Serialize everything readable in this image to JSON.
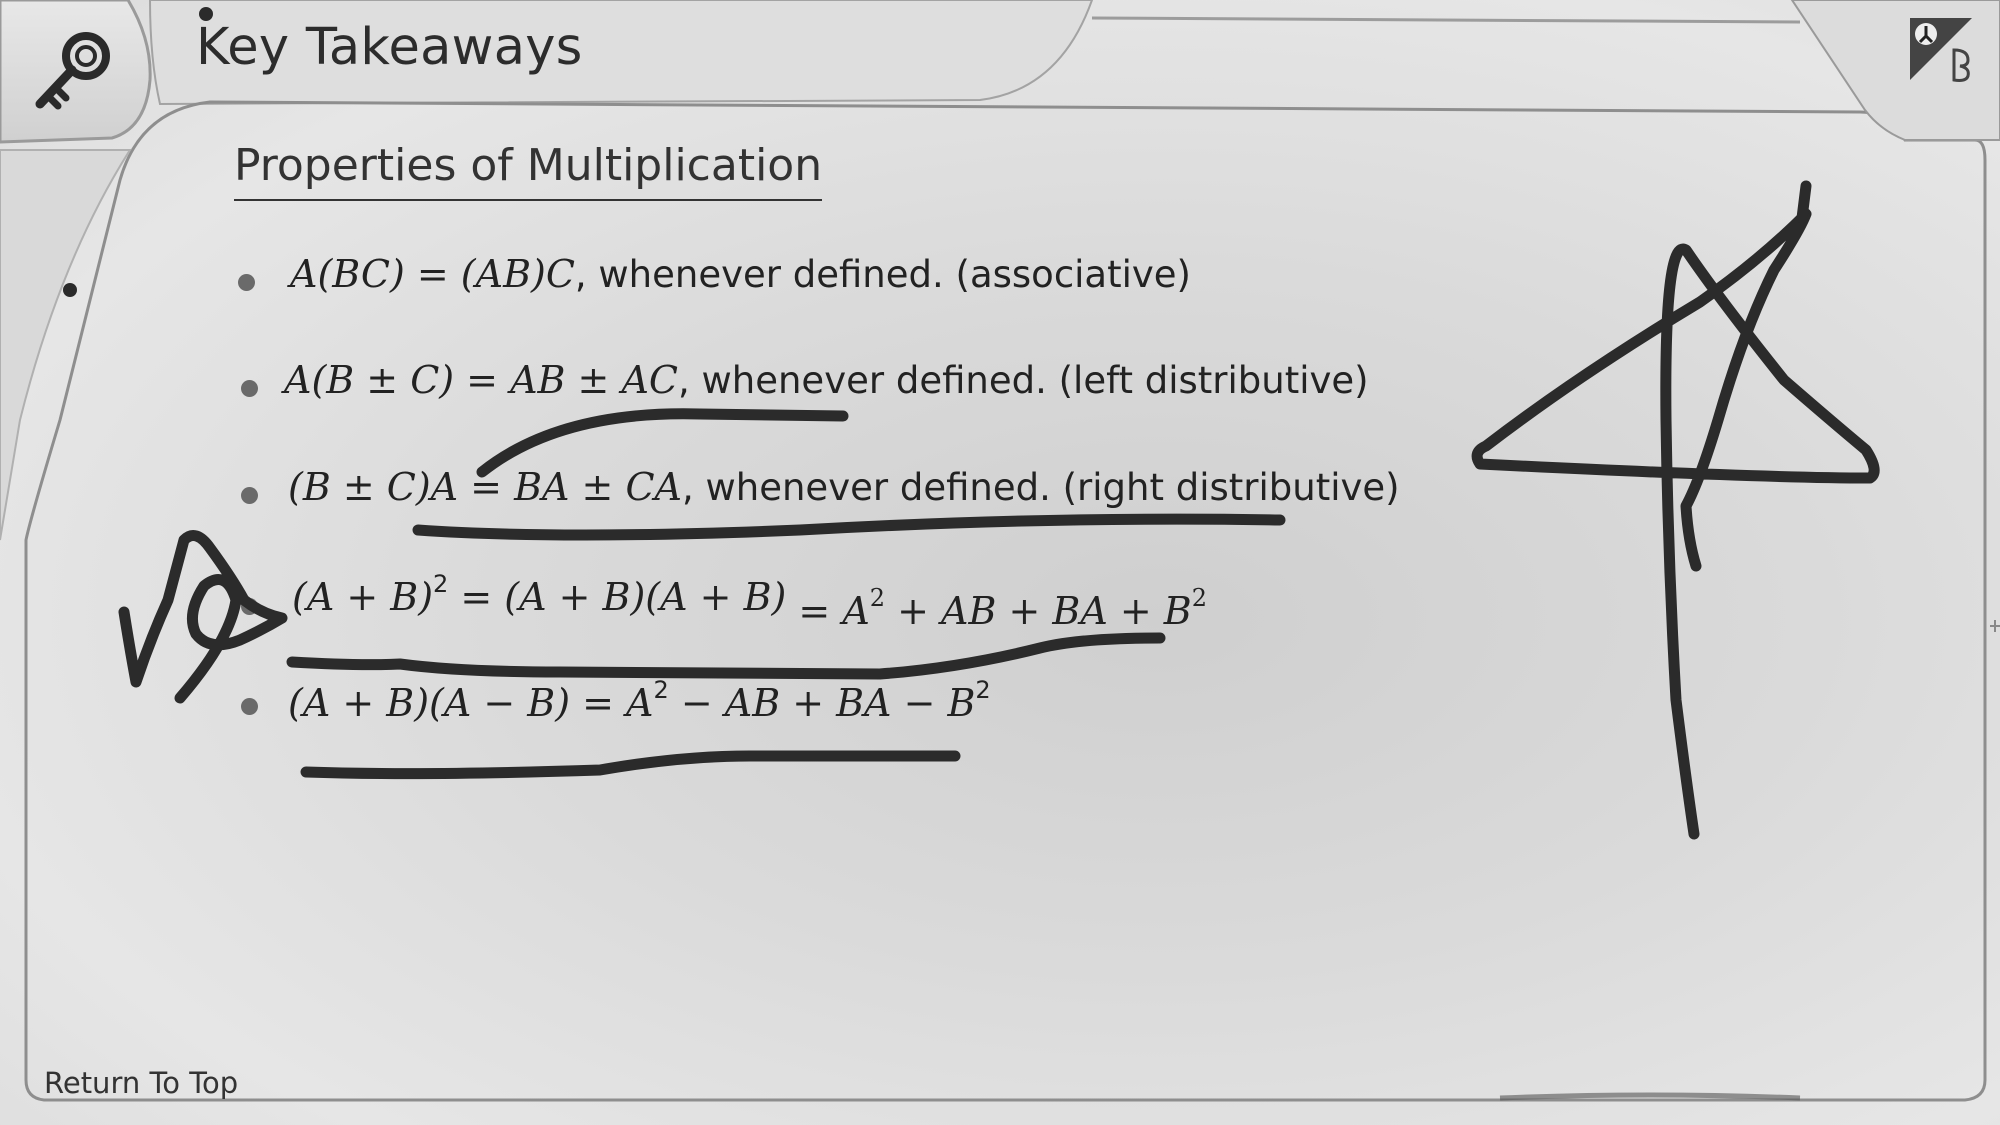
{
  "header": {
    "title": "Key Takeaways",
    "icon": "key-icon"
  },
  "section": {
    "title": "Properties of Multiplication"
  },
  "bullets": [
    {
      "math": "A(BC) = (AB)C",
      "text": ", whenever defined. (associative)"
    },
    {
      "math": "A(B ± C) = AB ± AC",
      "text": ", whenever defined. (left distributive)"
    },
    {
      "math": "(B ± C)A = BA ± CA",
      "text": ", whenever defined. (right distributive)"
    },
    {
      "math_a": "(A + B)",
      "exp_a": "2",
      "math_b": " = (A + B)(A + B)",
      "handwritten_a": " = A",
      "hexp_a": "2",
      "handwritten_b": " + AB + BA + B",
      "hexp_b": "2"
    },
    {
      "math_a": "(A + B)(A − B) = A",
      "exp_a": "2",
      "math_b": " − AB + BA − B",
      "exp_b": "2"
    }
  ],
  "footer": {
    "return_label": "Return To Top"
  },
  "corner": {
    "icon": "presenter-pen-icon"
  },
  "colors": {
    "ink": "#2b2b2b",
    "text": "#222222",
    "frame": "#8a8a8a"
  }
}
